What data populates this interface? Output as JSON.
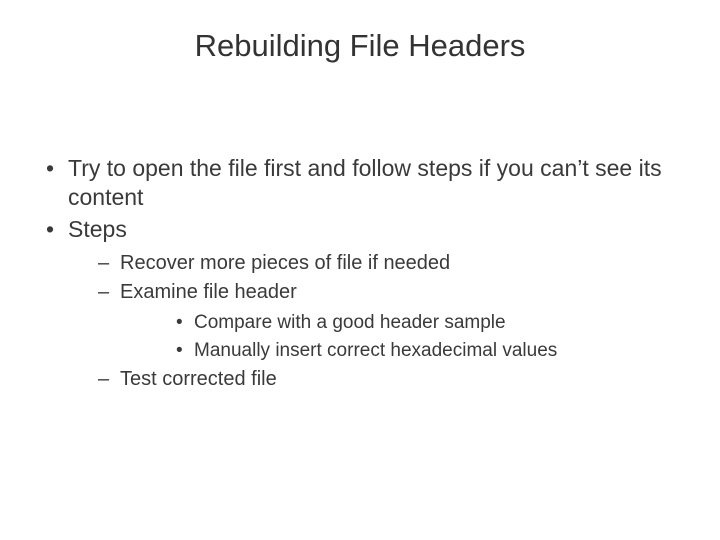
{
  "title": "Rebuilding File Headers",
  "bullets": {
    "l1_0": "Try to open the file first and follow steps if you can’t see its content",
    "l1_1": "Steps",
    "l2_0": "Recover more pieces of file if needed",
    "l2_1": "Examine file header",
    "l3_0": "Compare with a good header sample",
    "l3_1": "Manually insert correct hexadecimal values",
    "l2_2": "Test corrected file"
  }
}
